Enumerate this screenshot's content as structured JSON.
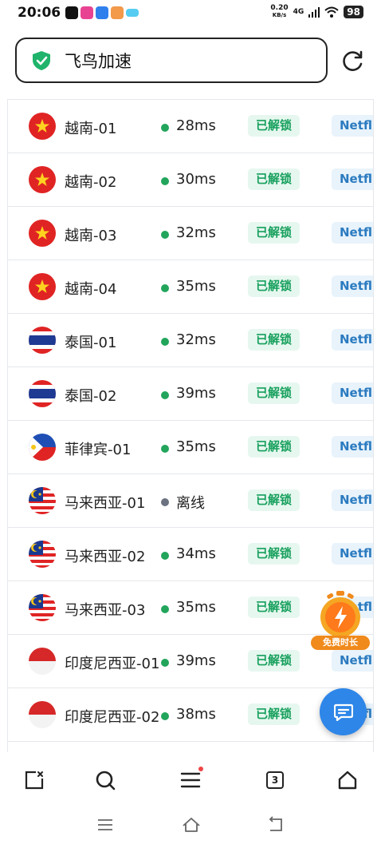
{
  "status_bar": {
    "time": "20:06",
    "net_speed_value": "0.20",
    "net_speed_unit": "KB/s",
    "network": "4G",
    "battery": "98"
  },
  "search": {
    "text": "飞鸟加速",
    "shield_color": "#1fb36b"
  },
  "list": {
    "rows": [
      {
        "flag": "vietnam-flag-icon",
        "name": "越南-01",
        "status_color": "#22a55b",
        "latency": "28ms",
        "badge": "已解锁",
        "stream": "Netfli"
      },
      {
        "flag": "vietnam-flag-icon",
        "name": "越南-02",
        "status_color": "#22a55b",
        "latency": "30ms",
        "badge": "已解锁",
        "stream": "Netfli"
      },
      {
        "flag": "vietnam-flag-icon",
        "name": "越南-03",
        "status_color": "#22a55b",
        "latency": "32ms",
        "badge": "已解锁",
        "stream": "Netfli"
      },
      {
        "flag": "vietnam-flag-icon",
        "name": "越南-04",
        "status_color": "#22a55b",
        "latency": "35ms",
        "badge": "已解锁",
        "stream": "Netfli"
      },
      {
        "flag": "thailand-flag-icon",
        "name": "泰国-01",
        "status_color": "#22a55b",
        "latency": "32ms",
        "badge": "已解锁",
        "stream": "Netfli"
      },
      {
        "flag": "thailand-flag-icon",
        "name": "泰国-02",
        "status_color": "#22a55b",
        "latency": "39ms",
        "badge": "已解锁",
        "stream": "Netfli"
      },
      {
        "flag": "philippines-flag-icon",
        "name": "菲律宾-01",
        "status_color": "#22a55b",
        "latency": "35ms",
        "badge": "已解锁",
        "stream": "Netfli"
      },
      {
        "flag": "malaysia-flag-icon",
        "name": "马来西亚-01",
        "status_color": "#6b7280",
        "latency": "离线",
        "badge": "已解锁",
        "stream": "Netfli"
      },
      {
        "flag": "malaysia-flag-icon",
        "name": "马来西亚-02",
        "status_color": "#22a55b",
        "latency": "34ms",
        "badge": "已解锁",
        "stream": "Netfli"
      },
      {
        "flag": "malaysia-flag-icon",
        "name": "马来西亚-03",
        "status_color": "#22a55b",
        "latency": "35ms",
        "badge": "已解锁",
        "stream": "Netfli"
      },
      {
        "flag": "indonesia-flag-icon",
        "name": "印度尼西亚-01",
        "status_color": "#22a55b",
        "latency": "39ms",
        "badge": "已解锁",
        "stream": "Netfli"
      },
      {
        "flag": "indonesia-flag-icon",
        "name": "印度尼西亚-02",
        "status_color": "#22a55b",
        "latency": "38ms",
        "badge": "已解锁",
        "stream": "Netfli"
      }
    ]
  },
  "floating": {
    "promo_label": "免费时长",
    "chat_icon": "chat-icon"
  },
  "toolbar": {
    "tab_count": "3",
    "icons": [
      "close-tab-icon",
      "search-icon",
      "menu-icon",
      "tabs-icon",
      "home-icon"
    ]
  },
  "colors": {
    "badge_green": "#17a05d",
    "stream_blue": "#2b7bc0",
    "fab_blue": "#2e86e8",
    "promo_orange": "#f08a1c"
  }
}
